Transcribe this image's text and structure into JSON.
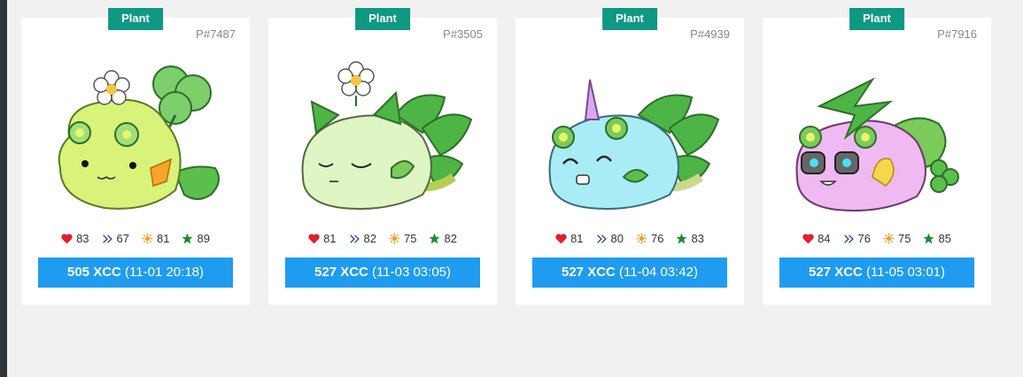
{
  "cards": [
    {
      "badge": "Plant",
      "id": "P#7487",
      "stats": {
        "hp": "83",
        "speed": "67",
        "skill": "81",
        "morale": "89"
      },
      "price": "505 XCC",
      "time": "(11-01 20:18)",
      "body_color": "#d8f27a"
    },
    {
      "badge": "Plant",
      "id": "P#3505",
      "stats": {
        "hp": "81",
        "speed": "82",
        "skill": "75",
        "morale": "82"
      },
      "price": "527 XCC",
      "time": "(11-03 03:05)",
      "body_color": "#dff5c4"
    },
    {
      "badge": "Plant",
      "id": "P#4939",
      "stats": {
        "hp": "81",
        "speed": "80",
        "skill": "76",
        "morale": "83"
      },
      "price": "527 XCC",
      "time": "(11-04 03:42)",
      "body_color": "#a9ecf6"
    },
    {
      "badge": "Plant",
      "id": "P#7916",
      "stats": {
        "hp": "84",
        "speed": "76",
        "skill": "75",
        "morale": "85"
      },
      "price": "527 XCC",
      "time": "(11-05 03:01)",
      "body_color": "#efb9f2"
    }
  ],
  "icons": {
    "hp": "heart-icon",
    "speed": "double-chevron-icon",
    "skill": "sun-icon",
    "morale": "star-icon"
  },
  "colors": {
    "badge": "#0f9882",
    "button": "#1f9cf0",
    "heart": "#e0202c",
    "chevron": "#2a3fb0",
    "sun": "#f3a02a",
    "star": "#1b8a2d"
  }
}
